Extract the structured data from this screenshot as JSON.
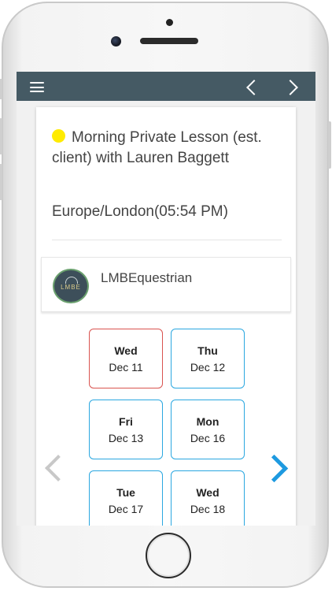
{
  "header": {
    "menu_icon": "hamburger-menu-icon",
    "prev_icon": "chevron-left-icon",
    "next_icon": "chevron-right-icon",
    "bar_color": "#455a64"
  },
  "appointment": {
    "status_color": "#ffeb00",
    "title": "Morning Private Lesson (est. client) with Lauren Baggett",
    "timezone": "Europe/London(05:54 PM)"
  },
  "business": {
    "logo_text": "LMBE",
    "name": "LMBEquestrian"
  },
  "dates": [
    {
      "day": "Wed",
      "date": "Dec 11",
      "selected": true
    },
    {
      "day": "Thu",
      "date": "Dec 12",
      "selected": false
    },
    {
      "day": "Fri",
      "date": "Dec 13",
      "selected": false
    },
    {
      "day": "Mon",
      "date": "Dec 16",
      "selected": false
    },
    {
      "day": "Tue",
      "date": "Dec 17",
      "selected": false
    },
    {
      "day": "Wed",
      "date": "Dec 18",
      "selected": false
    }
  ],
  "pager": {
    "prev_icon": "chevron-left-icon",
    "next_icon": "chevron-right-icon",
    "prev_color": "#c8c8c8",
    "next_color": "#1e9ae0"
  }
}
